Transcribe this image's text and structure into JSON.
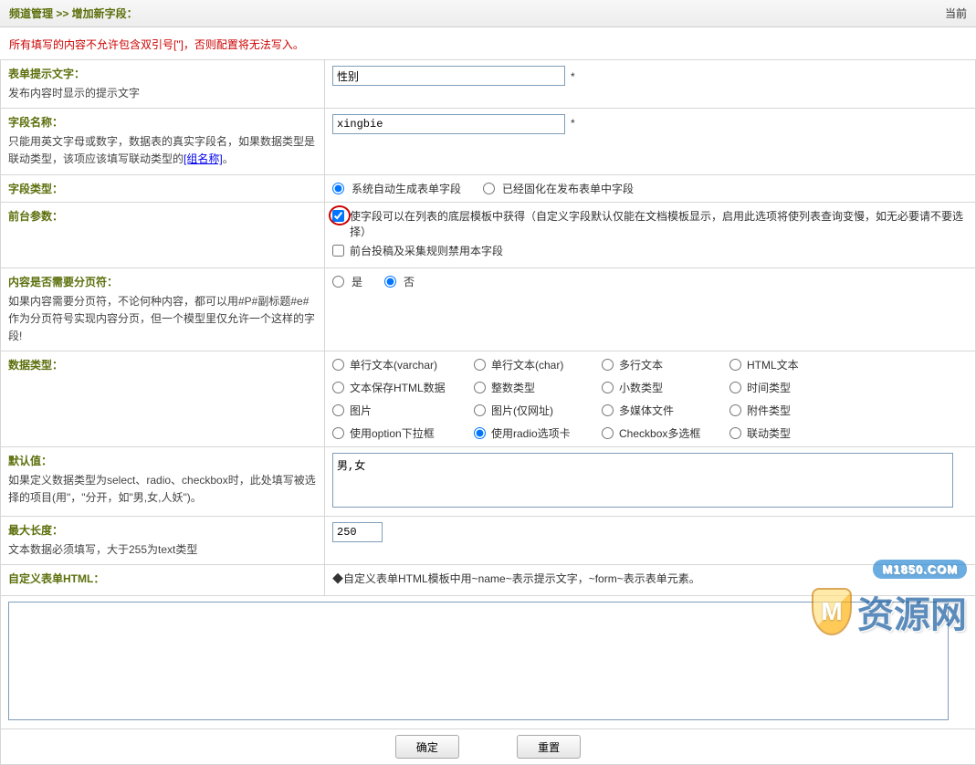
{
  "topbar": {
    "crumb": "频道管理 >> 增加新字段：",
    "right": "当前"
  },
  "warning": "所有填写的内容不允许包含双引号[\"]，否则配置将无法写入。",
  "rows": {
    "tip": {
      "title": "表单提示文字：",
      "desc": "发布内容时显示的提示文字",
      "value": "性别"
    },
    "name": {
      "title": "字段名称：",
      "desc_a": "只能用英文字母或数字，数据表的真实字段名，如果数据类型是联动类型，该项应该填写联动类型的",
      "desc_link": "[组名称]",
      "desc_b": "。",
      "value": "xingbie"
    },
    "ftype": {
      "title": "字段类型：",
      "opts": [
        "系统自动生成表单字段",
        "已经固化在发布表单中字段"
      ]
    },
    "front": {
      "title": "前台参数：",
      "opt1": "使字段可以在列表的底层模板中获得（自定义字段默认仅能在文档模板显示，启用此选项将使列表查询变慢，如无必要请不要选择）",
      "opt2": "前台投稿及采集规则禁用本字段"
    },
    "paging": {
      "title": "内容是否需要分页符：",
      "desc": "如果内容需要分页符，不论何种内容，都可以用#P#副标题#e#作为分页符号实现内容分页，但一个模型里仅允许一个这样的字段!",
      "yes": "是",
      "no": "否"
    },
    "dtype": {
      "title": "数据类型：",
      "opts": [
        "单行文本(varchar)",
        "单行文本(char)",
        "多行文本",
        "HTML文本",
        "文本保存HTML数据",
        "整数类型",
        "小数类型",
        "时间类型",
        "图片",
        "图片(仅网址)",
        "多媒体文件",
        "附件类型",
        "使用option下拉框",
        "使用radio选项卡",
        "Checkbox多选框",
        "联动类型"
      ]
    },
    "defval": {
      "title": "默认值：",
      "desc": "如果定义数据类型为select、radio、checkbox时，此处填写被选择的项目(用\"，\"分开，如\"男,女,人妖\")。",
      "value": "男,女"
    },
    "maxlen": {
      "title": "最大长度：",
      "desc": "文本数据必须填写，大于255为text类型",
      "value": "250"
    },
    "custom": {
      "title": "自定义表单HTML：",
      "note": "◆自定义表单HTML模板中用~name~表示提示文字，~form~表示表单元素。"
    }
  },
  "buttons": {
    "ok": "确定",
    "reset": "重置"
  },
  "watermark": {
    "pill": "M1850.COM",
    "text": "资源网"
  }
}
